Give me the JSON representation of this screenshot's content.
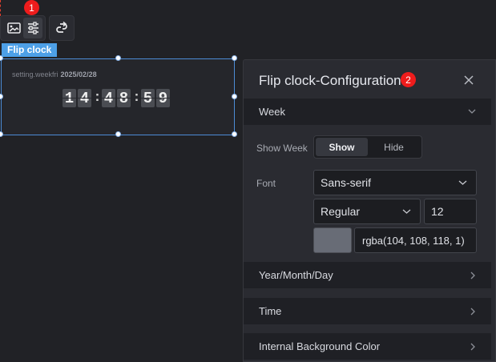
{
  "toolbar": {
    "badge": "1",
    "icons": [
      "image-icon",
      "sliders-icon",
      "link-icon"
    ]
  },
  "component": {
    "tag": "Flip clock",
    "week_text": "setting.weekfri",
    "date_text": "2025/02/28",
    "time": {
      "h1": "1",
      "h2": "4",
      "sep1": ":",
      "m1": "4",
      "m2": "8",
      "sep2": ":",
      "s1": "5",
      "s2": "9"
    }
  },
  "panel": {
    "title": "Flip clock-Configuration",
    "badge": "2",
    "sections": {
      "week": "Week",
      "ymd": "Year/Month/Day",
      "time": "Time",
      "internal_bg": "Internal Background Color"
    },
    "show_week": {
      "label": "Show Week",
      "options": [
        "Show",
        "Hide"
      ],
      "selected": "Show"
    },
    "font": {
      "label": "Font",
      "family": "Sans-serif",
      "weight": "Regular",
      "size": "12",
      "color": "rgba(104, 108, 118, 1)"
    }
  },
  "colors": {
    "accent": "#4da0e7",
    "badge": "#ee1c1c",
    "font_color": "#686c76"
  }
}
